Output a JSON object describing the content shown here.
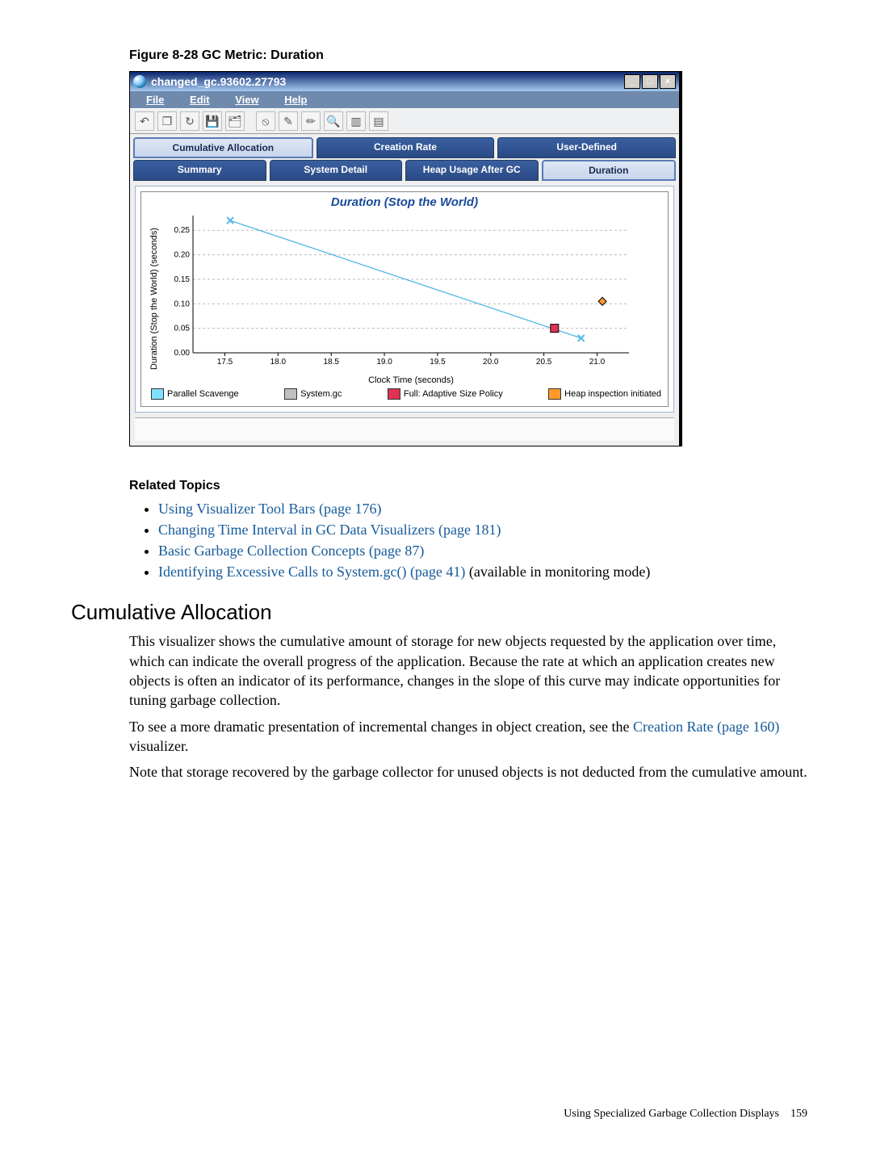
{
  "figure_caption": "Figure 8-28 GC Metric: Duration",
  "window": {
    "title": "changed_gc.93602.27793",
    "menus": [
      "File",
      "Edit",
      "View",
      "Help"
    ],
    "toolbar_icons": [
      "back-icon",
      "copy-icon",
      "refresh-icon",
      "save-icon",
      "saveall-icon",
      "cancel-icon",
      "wand-icon",
      "wand2-icon",
      "zoom-icon",
      "chart1-icon",
      "chart2-icon"
    ],
    "top_tabs": [
      {
        "label": "Cumulative Allocation",
        "active": true
      },
      {
        "label": "Creation Rate",
        "active": false
      },
      {
        "label": "User-Defined",
        "active": false
      }
    ],
    "bottom_tabs": [
      {
        "label": "Summary",
        "active": false
      },
      {
        "label": "System Detail",
        "active": false
      },
      {
        "label": "Heap Usage After GC",
        "active": false
      },
      {
        "label": "Duration",
        "active": true
      }
    ]
  },
  "chart_data": {
    "type": "line",
    "title": "Duration (Stop the World)",
    "xlabel": "Clock Time (seconds)",
    "ylabel": "Duration (Stop the World)  (seconds)",
    "x_ticks": [
      17.5,
      18.0,
      18.5,
      19.0,
      19.5,
      20.0,
      20.5,
      21.0
    ],
    "y_ticks": [
      0.0,
      0.05,
      0.1,
      0.15,
      0.2,
      0.25
    ],
    "xlim": [
      17.2,
      21.3
    ],
    "ylim": [
      0.0,
      0.28
    ],
    "colors": {
      "Parallel Scavenge": "#7fe0ff",
      "System.gc": "#c0c0c0",
      "Full: Adaptive Size Policy": "#dd3355",
      "Heap inspection initiated": "#ff9a2a"
    },
    "series": [
      {
        "name": "Parallel Scavenge",
        "x": [
          17.55,
          20.85
        ],
        "y": [
          0.27,
          0.03
        ],
        "marker": "x",
        "color": "#4fb8e8"
      },
      {
        "name": "Full: Adaptive Size Policy",
        "x": [
          20.6
        ],
        "y": [
          0.05
        ],
        "marker": "square",
        "color": "#dd3355"
      },
      {
        "name": "Heap inspection initiated",
        "x": [
          21.05
        ],
        "y": [
          0.105
        ],
        "marker": "diamond",
        "color": "#ff9a2a"
      }
    ],
    "legend": [
      "Parallel Scavenge",
      "System.gc",
      "Full: Adaptive Size Policy",
      "Heap inspection initiated"
    ]
  },
  "related_heading": "Related Topics",
  "related": [
    {
      "text": "Using Visualizer Tool Bars (page 176)",
      "link": true,
      "tail": ""
    },
    {
      "text": "Changing Time Interval in GC Data Visualizers (page 181)",
      "link": true,
      "tail": ""
    },
    {
      "text": "Basic Garbage Collection Concepts (page 87)",
      "link": true,
      "tail": ""
    },
    {
      "text": "Identifying Excessive Calls to System.gc() (page 41)",
      "link": true,
      "tail": " (available in monitoring mode)"
    }
  ],
  "section_heading": "Cumulative Allocation",
  "para1": "This visualizer shows the cumulative amount of storage for new objects requested by the application over time, which can indicate the overall progress of the application. Because the rate at which an application creates new objects is often an indicator of its performance, changes in the slope of this curve may indicate opportunities for tuning garbage collection.",
  "para2_pre": "To see a more dramatic presentation of incremental changes in object creation, see the ",
  "para2_link": "Creation Rate (page 160)",
  "para2_post": " visualizer.",
  "para3": "Note that storage recovered by the garbage collector for unused objects is not deducted from the cumulative amount.",
  "footer_text": "Using Specialized Garbage Collection Displays",
  "footer_page": "159"
}
